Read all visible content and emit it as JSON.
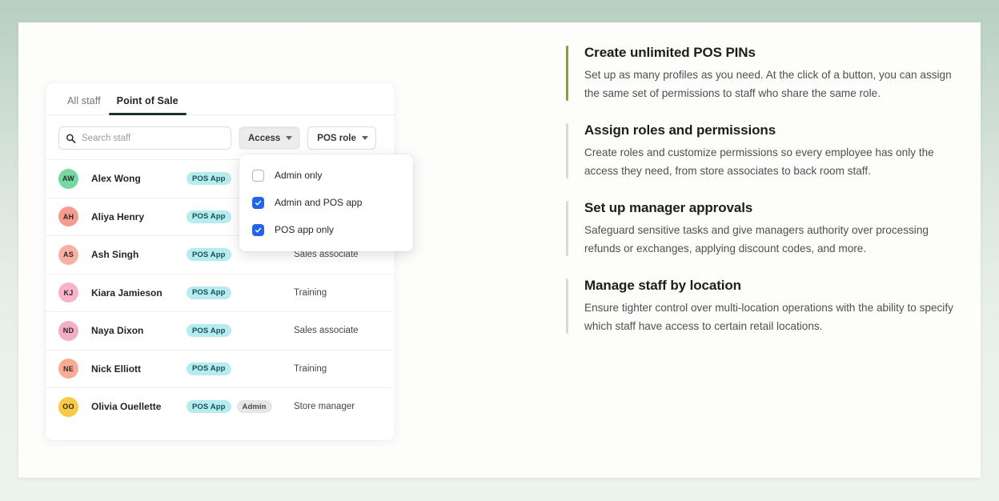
{
  "mock_app": {
    "tabs": [
      {
        "label": "All staff",
        "active": false
      },
      {
        "label": "Point of Sale",
        "active": true
      }
    ],
    "search": {
      "placeholder": "Search staff",
      "value": "",
      "icon": "search-icon"
    },
    "filters": [
      {
        "label": "Access",
        "pressed": true,
        "icon": "chevron-down-icon"
      },
      {
        "label": "POS role",
        "pressed": false,
        "icon": "chevron-down-icon"
      }
    ],
    "access_dropdown": {
      "options": [
        {
          "label": "Admin only",
          "checked": false
        },
        {
          "label": "Admin and POS app",
          "checked": true
        },
        {
          "label": "POS app only",
          "checked": true
        }
      ]
    },
    "staff": [
      {
        "initials": "AW",
        "name": "Alex Wong",
        "avatar_color": "#74d8a3",
        "badges": [
          "POS App"
        ],
        "role": ""
      },
      {
        "initials": "AH",
        "name": "Aliya Henry",
        "avatar_color": "#f59b90",
        "badges": [
          "POS App"
        ],
        "role": ""
      },
      {
        "initials": "AS",
        "name": "Ash Singh",
        "avatar_color": "#f9b0a4",
        "badges": [
          "POS App"
        ],
        "role": "Sales associate"
      },
      {
        "initials": "KJ",
        "name": "Kiara Jamieson",
        "avatar_color": "#f6b3cb",
        "badges": [
          "POS App"
        ],
        "role": "Training"
      },
      {
        "initials": "ND",
        "name": "Naya Dixon",
        "avatar_color": "#f4aec4",
        "badges": [
          "POS App"
        ],
        "role": "Sales associate"
      },
      {
        "initials": "NE",
        "name": "Nick Elliott",
        "avatar_color": "#f9ab93",
        "badges": [
          "POS App"
        ],
        "role": "Training"
      },
      {
        "initials": "OO",
        "name": "Olivia Ouellette",
        "avatar_color": "#f7c945",
        "badges": [
          "POS App",
          "Admin"
        ],
        "role": "Store manager"
      }
    ],
    "badge_colors": {
      "pos_app_bg": "#b7ecef",
      "pos_app_text": "#15505a",
      "admin_bg": "#e6e6e6",
      "admin_text": "#4a4a4a"
    }
  },
  "features": [
    {
      "title": "Create unlimited POS PINs",
      "body": "Set up as many profiles as you need. At the click of a button, you can assign the same set of permissions to staff who share the same role.",
      "accent": true,
      "accent_color": "#8b9b3e"
    },
    {
      "title": "Assign roles and permissions",
      "body": "Create roles and customize permissions so every employee has only the access they need, from store associates to back room staff.",
      "accent": false,
      "accent_color": "#d9d9d9"
    },
    {
      "title": "Set up manager approvals",
      "body": "Safeguard sensitive tasks and give managers authority over processing refunds or exchanges, applying discount codes, and more.",
      "accent": false,
      "accent_color": "#d9d9d9"
    },
    {
      "title": "Manage staff by location",
      "body": "Ensure tighter control over multi-location operations with the ability to specify which staff have access to certain retail locations.",
      "accent": false,
      "accent_color": "#d9d9d9"
    }
  ],
  "theme": {
    "page_bg_top": "#b6cfc0",
    "page_bg_bottom": "#ecf2ed",
    "card_bg": "#fdfdfc",
    "tab_underline": "#17332a",
    "checkbox_checked": "#2463eb"
  }
}
